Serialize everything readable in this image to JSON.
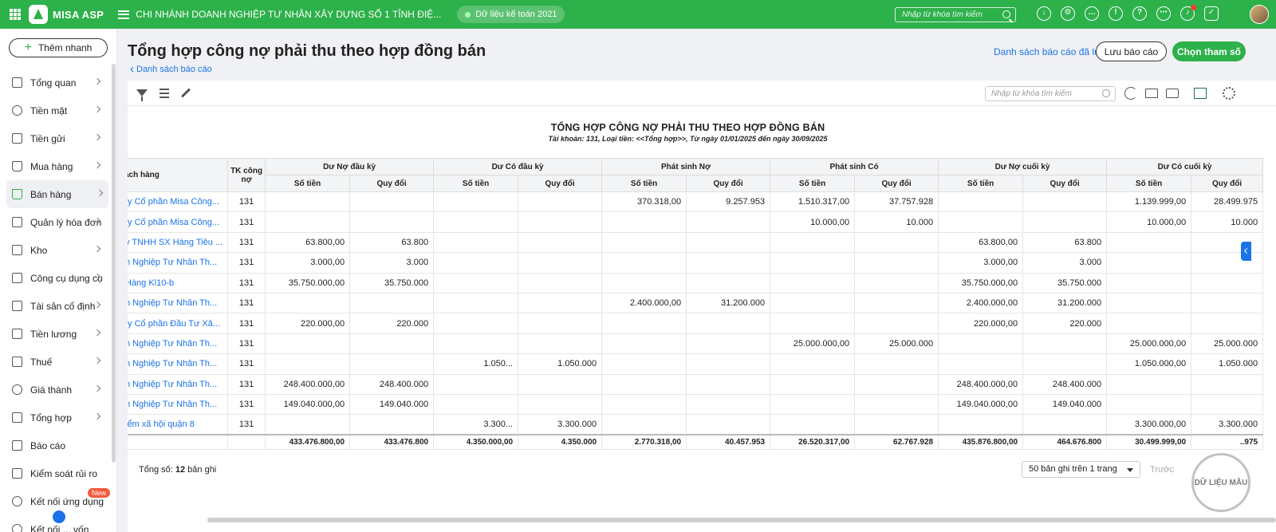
{
  "app": {
    "brand": "MISA ASP",
    "branch": "CHI NHÁNH DOANH NGHIỆP TƯ NHÂN XÂY DỰNG SỐ 1 TỈNH ĐIỆ...",
    "dataset": "Dữ liệu kế toán 2021",
    "search_placeholder": "Nhập từ khóa tìm kiếm",
    "primary_color": "#2db14a"
  },
  "sidebar": {
    "quick_add": "Thêm nhanh",
    "items": [
      {
        "label": "Tổng quan",
        "icon": "dashboard-icon"
      },
      {
        "label": "Tiền mặt",
        "icon": "money-bag-icon"
      },
      {
        "label": "Tiền gửi",
        "icon": "bank-icon"
      },
      {
        "label": "Mua hàng",
        "icon": "shopping-bag-icon"
      },
      {
        "label": "Bán hàng",
        "icon": "cart-icon"
      },
      {
        "label": "Quản lý hóa đơn",
        "icon": "invoice-icon"
      },
      {
        "label": "Kho",
        "icon": "warehouse-icon"
      },
      {
        "label": "Công cụ dụng cụ",
        "icon": "tools-icon"
      },
      {
        "label": "Tài sản cố định",
        "icon": "car-icon"
      },
      {
        "label": "Tiền lương",
        "icon": "salary-icon"
      },
      {
        "label": "Thuế",
        "icon": "tax-icon"
      },
      {
        "label": "Giá thành",
        "icon": "price-tag-icon"
      },
      {
        "label": "Tổng hợp",
        "icon": "ledger-icon"
      },
      {
        "label": "Báo cáo",
        "icon": "report-icon"
      },
      {
        "label": "Kiểm soát rủi ro",
        "icon": "risk-icon"
      },
      {
        "label": "Kết nối ứng dụng",
        "icon": "connect-icon",
        "badge": "New"
      },
      {
        "label": "Kết nối ... vốn",
        "icon": "link-icon"
      }
    ]
  },
  "header": {
    "title": "Tổng hợp công nợ phải thu theo hợp đồng bán",
    "back": "Danh sách báo cáo",
    "saved_reports": "Danh sách báo cáo đã lưu",
    "save_button": "Lưu báo cáo",
    "params_button": "Chọn tham số"
  },
  "toolbar": {
    "search_placeholder": "Nhập từ khóa tìm kiếm"
  },
  "report": {
    "title": "TỔNG HỢP CÔNG NỢ PHẢI THU THEO HỢP ĐỒNG BÁN",
    "subtitle": "Tài khoản: 131, Loại tiền: <<Tổng hợp>>, Từ ngày 01/01/2025 đến ngày 30/09/2025",
    "col_customer": "ách hàng",
    "col_tk": "TK công nợ",
    "groups": [
      "Dư Nợ đầu kỳ",
      "Dư Có đầu kỳ",
      "Phát sinh Nợ",
      "Phát sinh Có",
      "Dư Nợ cuối kỳ",
      "Dư Có cuối kỳ"
    ],
    "sub_amount": "Số tiền",
    "sub_converted": "Quy đổi",
    "rows": [
      [
        "ty Cổ phần Misa Công...",
        "131",
        "",
        "",
        "",
        "",
        "370.318,00",
        "9.257.953",
        "1.510.317,00",
        "37.757.928",
        "",
        "",
        "1.139.999,00",
        "28.499.975"
      ],
      [
        "ty Cổ phần Misa Công...",
        "131",
        "",
        "",
        "",
        "",
        "",
        "",
        "10.000,00",
        "10.000",
        "",
        "",
        "10.000,00",
        "10.000"
      ],
      [
        "y TNHH SX Hàng Tiêu ...",
        "131",
        "63.800,00",
        "63.800",
        "",
        "",
        "",
        "",
        "",
        "",
        "63.800,00",
        "63.800",
        "",
        ""
      ],
      [
        "n Nghiệp Tư Nhân Th...",
        "131",
        "3.000,00",
        "3.000",
        "",
        "",
        "",
        "",
        "",
        "",
        "3.000,00",
        "3.000",
        "",
        ""
      ],
      [
        " Hàng Kl10-b",
        "131",
        "35.750.000,00",
        "35.750.000",
        "",
        "",
        "",
        "",
        "",
        "",
        "35.750.000,00",
        "35.750.000",
        "",
        ""
      ],
      [
        "n Nghiệp Tư Nhân Th...",
        "131",
        "",
        "",
        "",
        "",
        "2.400.000,00",
        "31.200.000",
        "",
        "",
        "2.400.000,00",
        "31.200.000",
        "",
        ""
      ],
      [
        "ty Cổ phần Đầu Tư Xâ...",
        "131",
        "220.000,00",
        "220.000",
        "",
        "",
        "",
        "",
        "",
        "",
        "220.000,00",
        "220.000",
        "",
        ""
      ],
      [
        "n Nghiệp Tư Nhân Th...",
        "131",
        "",
        "",
        "",
        "",
        "",
        "",
        "25.000.000,00",
        "25.000.000",
        "",
        "",
        "25.000.000,00",
        "25.000.000"
      ],
      [
        "n Nghiệp Tư Nhân Th...",
        "131",
        "",
        "",
        "1.050...",
        "1.050.000",
        "",
        "",
        "",
        "",
        "",
        "",
        "1.050.000,00",
        "1.050.000"
      ],
      [
        "n Nghiệp Tư Nhân Th...",
        "131",
        "248.400.000,00",
        "248.400.000",
        "",
        "",
        "",
        "",
        "",
        "",
        "248.400.000,00",
        "248.400.000",
        "",
        ""
      ],
      [
        "n Nghiệp Tư Nhân Th...",
        "131",
        "149.040.000,00",
        "149.040.000",
        "",
        "",
        "",
        "",
        "",
        "",
        "149.040.000,00",
        "149.040.000",
        "",
        ""
      ],
      [
        "iểm xã hội quận 8",
        "131",
        "",
        "",
        "3.300...",
        "3.300.000",
        "",
        "",
        "",
        "",
        "",
        "",
        "3.300.000,00",
        "3.300.000"
      ]
    ],
    "totals": [
      "",
      "",
      "433.476.800,00",
      "433.476.800",
      "4.350.000,00",
      "4.350.000",
      "2.770.318,00",
      "40.457.953",
      "26.520.317,00",
      "62.767.928",
      "435.876.800,00",
      "464.676.800",
      "30.499.999,00",
      "..975"
    ]
  },
  "footer": {
    "total_label": "Tổng số: ",
    "total_count": "12",
    "total_suffix": " bản ghi",
    "page_size": "50 bản ghi trên 1 trang",
    "prev": "Trước"
  },
  "watermark": "DỮ LIỆU MẪU"
}
